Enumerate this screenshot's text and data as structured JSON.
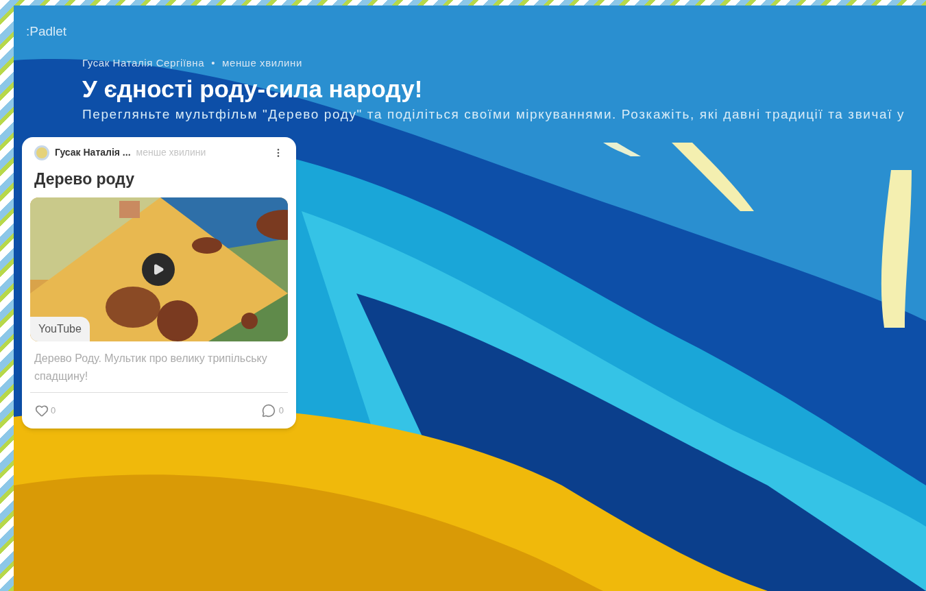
{
  "brand": ":Padlet",
  "header": {
    "author": "Гусак Наталія Сергіївна",
    "separator": "•",
    "time": "менше хвилини",
    "title": "У єдності роду-сила народу!",
    "description": "Перегляньте мультфільм \"Дерево роду\" та поділіться своїми міркуваннями. Розкажіть, які давні традиції та звичаї у"
  },
  "post": {
    "author": "Гусак Наталія ...",
    "time": "менше хвилини",
    "title": "Дерево роду",
    "media": {
      "kind": "video",
      "source": "YouTube"
    },
    "caption": "Дерево Роду. Мультик про велику трипільську спадщину!",
    "likes": "0",
    "comments": "0"
  }
}
